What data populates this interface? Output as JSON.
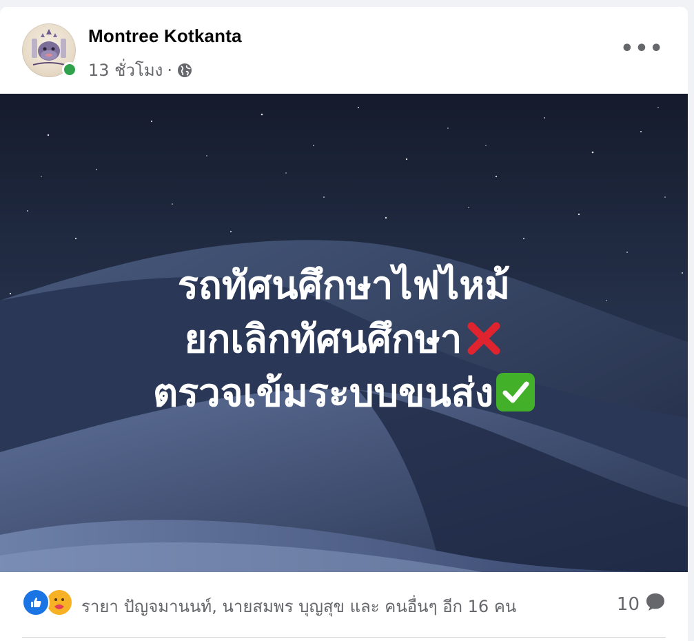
{
  "post": {
    "author": "Montree Kotkanta",
    "time": "13 ชั่วโมง",
    "separator": "·",
    "privacy_icon": "globe-icon",
    "more_icon": "more-horizontal-icon",
    "more_label": "•••"
  },
  "image_text": {
    "line1": "รถทัศนศึกษาไฟไหม้",
    "line2": "ยกเลิกทัศนศึกษา",
    "line2_emoji": "cross-mark-emoji",
    "line3": "ตรวจเข้มระบบขนส่ง",
    "line3_emoji": "check-mark-button-emoji"
  },
  "reactions": {
    "icons": [
      "like-icon",
      "care-icon"
    ],
    "names": "รายา ปัญจมานนท์, นายสมพร บุญสุข และ คนอื่นๆ อีก 16 คน"
  },
  "comments": {
    "count": "10",
    "icon": "comment-bubble-icon"
  },
  "colors": {
    "online": "#31a24c",
    "like_blue": "#1b74e4",
    "care_yellow": "#f7b125",
    "secondary_text": "#65676b",
    "cross_red": "#e0242f",
    "check_green": "#43b02a"
  }
}
